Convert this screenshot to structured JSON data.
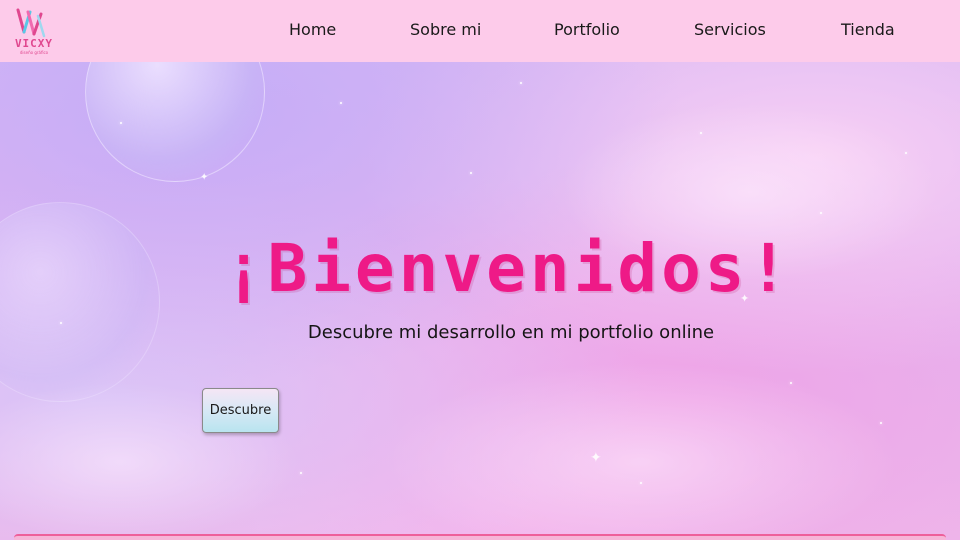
{
  "brand": {
    "name": "VICXY",
    "tagline": "diseño gráfico",
    "logo_icon": "vicxy-logo-icon",
    "color": "#e0478f"
  },
  "nav": {
    "items": [
      {
        "label": "Home"
      },
      {
        "label": "Sobre mi"
      },
      {
        "label": "Portfolio"
      },
      {
        "label": "Servicios"
      },
      {
        "label": "Tienda"
      }
    ],
    "background": "#fdcbea"
  },
  "hero": {
    "title": "¡Bienvenidos!",
    "subtitle": "Descubre mi desarrollo en mi portfolio online",
    "button_label": "Descubre",
    "title_color": "#ee1a87"
  }
}
